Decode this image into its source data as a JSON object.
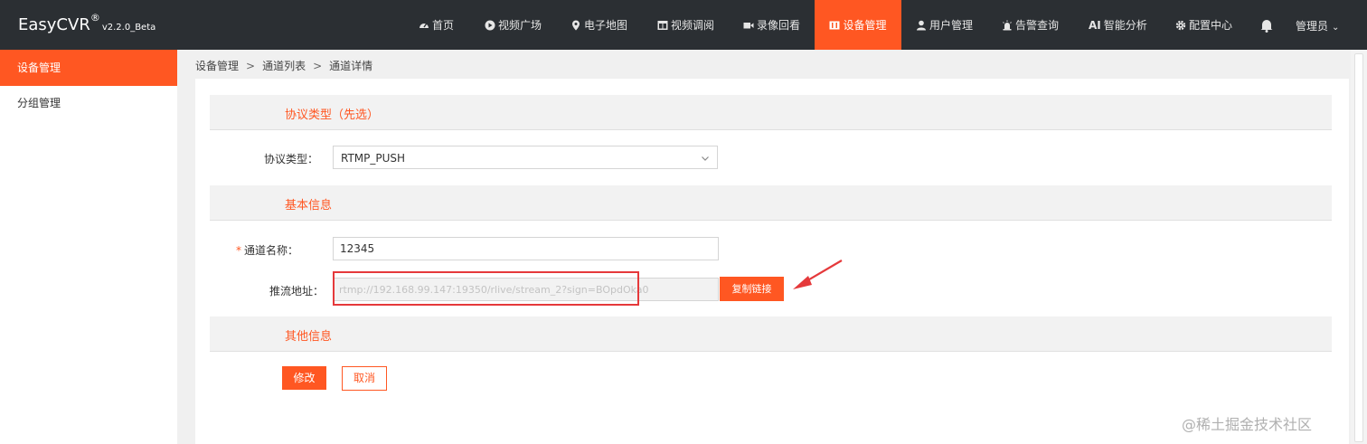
{
  "brand": {
    "name": "EasyCVR",
    "registered": "®",
    "version": "v2.2.0_Beta"
  },
  "nav": [
    {
      "label": "首页",
      "icon": "dashboard-icon"
    },
    {
      "label": "视频广场",
      "icon": "play-circle-icon"
    },
    {
      "label": "电子地图",
      "icon": "map-pin-icon"
    },
    {
      "label": "视频调阅",
      "icon": "grid-window-icon"
    },
    {
      "label": "录像回看",
      "icon": "video-camera-icon"
    },
    {
      "label": "设备管理",
      "icon": "device-icon",
      "active": true
    },
    {
      "label": "用户管理",
      "icon": "user-icon"
    },
    {
      "label": "告警查询",
      "icon": "alarm-icon"
    },
    {
      "label": "智能分析",
      "icon": "ai-icon",
      "prefix": "AI"
    },
    {
      "label": "配置中心",
      "icon": "gear-icon"
    }
  ],
  "header": {
    "user": "管理员",
    "bell_icon": "bell-icon"
  },
  "sidebar": {
    "items": [
      {
        "label": "设备管理",
        "active": true
      },
      {
        "label": "分组管理"
      }
    ]
  },
  "breadcrumb": [
    "设备管理",
    "通道列表",
    "通道详情"
  ],
  "breadcrumb_separator": ">",
  "sections": {
    "protocol": "协议类型（先选）",
    "basic": "基本信息",
    "other": "其他信息"
  },
  "form": {
    "protocol_label": "协议类型：",
    "protocol_value": "RTMP_PUSH",
    "name_label": "通道名称：",
    "name_required_mark": "*",
    "name_value": "12345",
    "push_label": "推流地址：",
    "push_url": "rtmp://192.168.99.147:19350/rlive/stream_2?sign=BOpdOka0",
    "copy_label": "复制链接"
  },
  "actions": {
    "edit": "修改",
    "cancel": "取消"
  },
  "watermark": "@稀土掘金技术社区",
  "colors": {
    "accent": "#ff5722",
    "topbar": "#2b2f33",
    "highlight": "#e5393b"
  }
}
